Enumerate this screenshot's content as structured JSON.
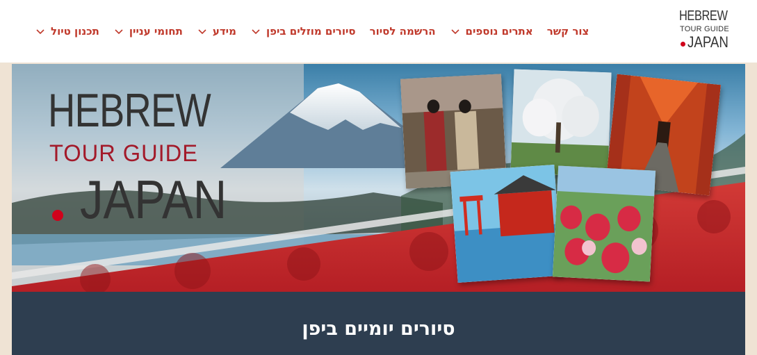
{
  "logo": {
    "line1": "HEBREW",
    "line2": "TOUR GUIDE",
    "line3": "JAPAN"
  },
  "nav": {
    "items": [
      {
        "label": "תכנון טיול",
        "has_dropdown": true
      },
      {
        "label": "תחומי עניין",
        "has_dropdown": true
      },
      {
        "label": "מידע",
        "has_dropdown": true
      },
      {
        "label": "סיורים מוזלים ביפן",
        "has_dropdown": true
      },
      {
        "label": "הרשמה לסיור",
        "has_dropdown": false
      },
      {
        "label": "אתרים נוספים",
        "has_dropdown": true
      },
      {
        "label": "צור קשר",
        "has_dropdown": false
      }
    ]
  },
  "banner": {
    "logo_line1": "HEBREW",
    "logo_line2": "TOUR GUIDE",
    "logo_line3": "JAPAN"
  },
  "section": {
    "title": "סיורים יומיים ביפן"
  },
  "colors": {
    "nav_text": "#c0392b",
    "logo_dot": "#d0021b",
    "section_bg": "#2e3e50",
    "page_bg": "#efe3d4"
  }
}
